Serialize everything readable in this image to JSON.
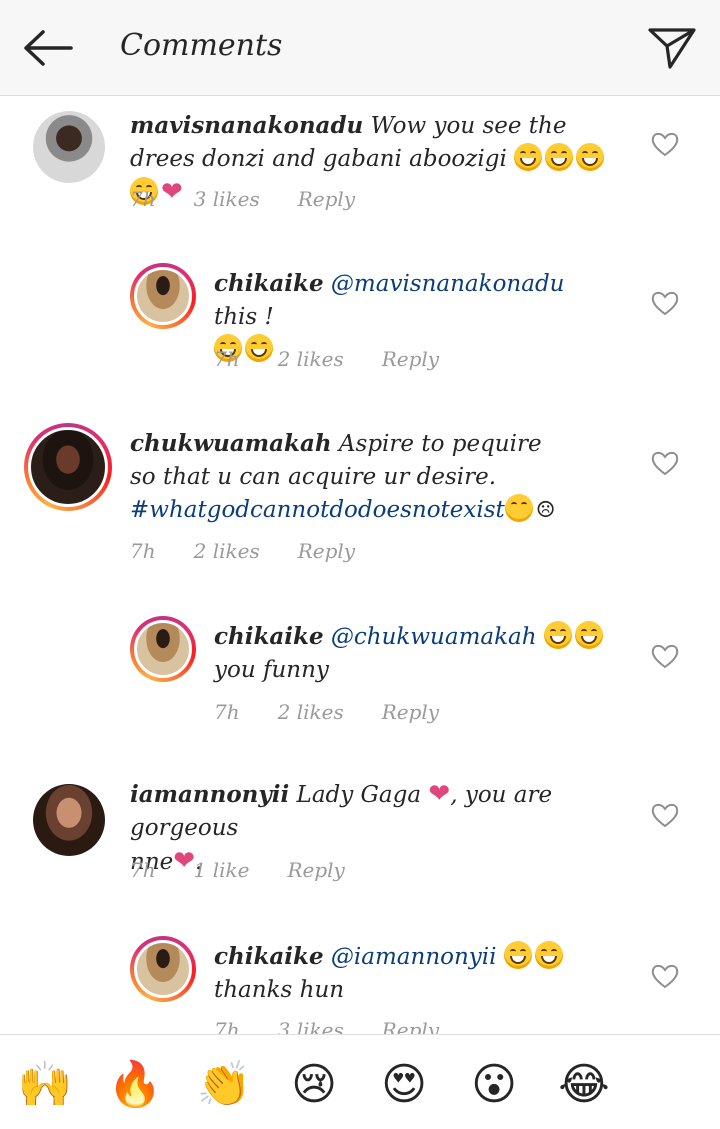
{
  "header": {
    "title": "Comments"
  },
  "comments": [
    {
      "username": "mavisnanakonadu",
      "text": "Wow you see the drees donzi and gabani aboozigi",
      "time": "7h",
      "likes": "3 likes",
      "reply": "Reply"
    },
    {
      "username": "chikaike",
      "mention": "@mavisnanakonadu",
      "text": "this !",
      "time": "7h",
      "likes": "2 likes",
      "reply": "Reply"
    },
    {
      "username": "chukwuamakah",
      "text1": "Aspire to pequire",
      "text2": "so that u can acquire ur desire.",
      "hashtag": "#whatgodcannotdodoesnotexist",
      "time": "7h",
      "likes": "2 likes",
      "reply": "Reply"
    },
    {
      "username": "chikaike",
      "mention": "@chukwuamakah",
      "text": "you funny",
      "time": "7h",
      "likes": "2 likes",
      "reply": "Reply"
    },
    {
      "username": "iamannonyii",
      "text1": "Lady Gaga",
      "text2": ", you are gorgeous",
      "text3": "nne",
      "text4": ".",
      "time": "7h",
      "likes": "1 like",
      "reply": "Reply"
    },
    {
      "username": "chikaike",
      "mention": "@iamannonyii",
      "text": "thanks hun",
      "time": "7h",
      "likes": "3 likes",
      "reply": "Reply"
    }
  ],
  "reactions": [
    "🙌",
    "🔥",
    "👏",
    "😢",
    "😍",
    "😮",
    "😂"
  ],
  "icons": {
    "back": "arrow-left-icon",
    "send": "paper-plane-icon",
    "like": "heart-outline-icon"
  }
}
